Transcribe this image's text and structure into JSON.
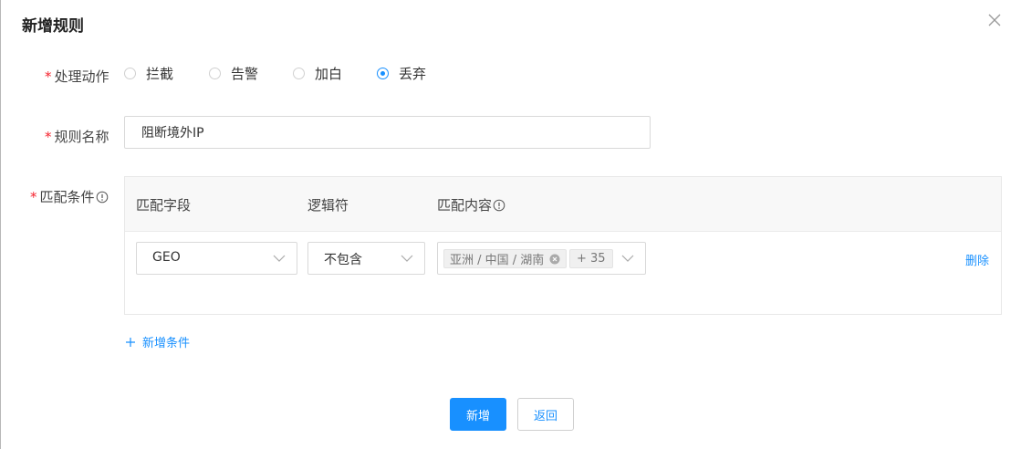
{
  "dialog": {
    "title": "新增规则"
  },
  "form": {
    "action": {
      "label": "处理动作",
      "options": [
        {
          "label": "拦截",
          "checked": false
        },
        {
          "label": "告警",
          "checked": false
        },
        {
          "label": "加白",
          "checked": false
        },
        {
          "label": "丢弃",
          "checked": true
        }
      ]
    },
    "name": {
      "label": "规则名称",
      "value": "阻断境外IP"
    },
    "conditions": {
      "label": "匹配条件",
      "headers": {
        "field": "匹配字段",
        "operator": "逻辑符",
        "content": "匹配内容"
      },
      "rows": [
        {
          "field": "GEO",
          "operator": "不包含",
          "content_tag": "亚洲 / 中国 / 湖南",
          "more_tag": "+ 35",
          "delete_label": "删除"
        }
      ],
      "add_label": "新增条件"
    }
  },
  "footer": {
    "submit_label": "新增",
    "back_label": "返回"
  },
  "colors": {
    "primary": "#1890ff",
    "required": "#f5222d"
  }
}
